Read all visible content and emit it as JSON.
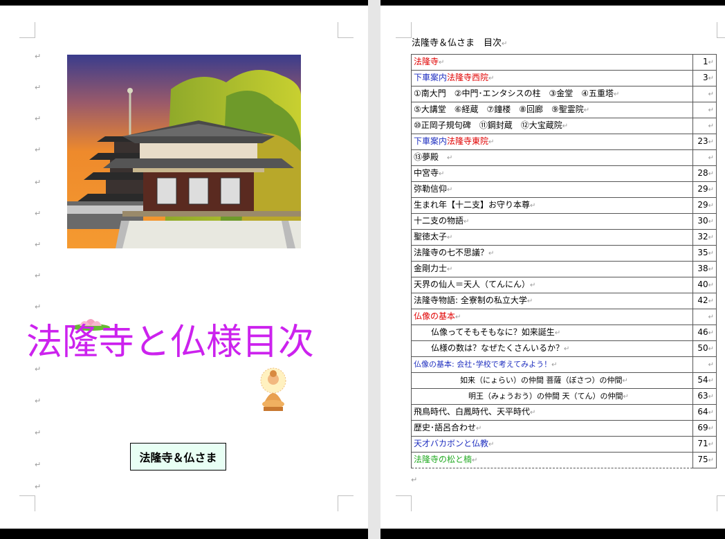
{
  "left_page": {
    "title": "法隆寺と仏様目次",
    "label": "法隆寺＆仏さま",
    "paragraph_mark": "↵"
  },
  "right_page": {
    "heading": "法隆寺＆仏さま　目次",
    "trailing_mark": "↵",
    "toc": [
      {
        "parts": [
          {
            "t": "法隆寺",
            "c": "red"
          }
        ],
        "page": "1"
      },
      {
        "parts": [
          {
            "t": "下車案内",
            "c": "blue"
          },
          {
            "t": "法隆寺西院",
            "c": "red"
          }
        ],
        "page": "3"
      },
      {
        "parts": [
          {
            "t": "①南大門　②中門･エンタシスの柱　③金堂　④五重塔",
            "c": "black"
          }
        ],
        "page": ""
      },
      {
        "parts": [
          {
            "t": "⑤大講堂　⑥経蔵　⑦鐘楼　⑧回廊　⑨聖霊院",
            "c": "black"
          }
        ],
        "page": ""
      },
      {
        "parts": [
          {
            "t": "⑩正岡子規句碑　⑪鋼封蔵　⑫大宝蔵院",
            "c": "black"
          }
        ],
        "page": ""
      },
      {
        "parts": [
          {
            "t": "下車案内",
            "c": "blue"
          },
          {
            "t": "法隆寺東院",
            "c": "red"
          }
        ],
        "page": "23"
      },
      {
        "parts": [
          {
            "t": "⑬夢殿　",
            "c": "black"
          }
        ],
        "page": ""
      },
      {
        "parts": [
          {
            "t": "中宮寺",
            "c": "black"
          }
        ],
        "page": "28"
      },
      {
        "parts": [
          {
            "t": "弥勒信仰",
            "c": "black"
          }
        ],
        "page": "29"
      },
      {
        "parts": [
          {
            "t": "生まれ年【十二支】お守り本尊",
            "c": "black"
          }
        ],
        "page": "29"
      },
      {
        "parts": [
          {
            "t": "十二支の物語",
            "c": "black"
          }
        ],
        "page": "30"
      },
      {
        "parts": [
          {
            "t": "聖徳太子",
            "c": "black"
          }
        ],
        "page": "32"
      },
      {
        "parts": [
          {
            "t": "法隆寺の七不思議？",
            "c": "black"
          }
        ],
        "page": "35"
      },
      {
        "parts": [
          {
            "t": "金剛力士",
            "c": "black"
          }
        ],
        "page": "38"
      },
      {
        "parts": [
          {
            "t": "天界の仙人＝天人（てんにん）",
            "c": "black"
          }
        ],
        "page": "40"
      },
      {
        "parts": [
          {
            "t": "法隆寺物語: 全寮制の私立大学",
            "c": "black"
          }
        ],
        "page": "42"
      },
      {
        "parts": [
          {
            "t": "仏像の基本",
            "c": "red"
          }
        ],
        "page": ""
      },
      {
        "parts": [
          {
            "t": "仏像ってそもそもなに？如来誕生",
            "c": "black"
          }
        ],
        "page": "46",
        "indent": 1
      },
      {
        "parts": [
          {
            "t": "仏様の数は？なぜたくさんいるか？",
            "c": "black"
          }
        ],
        "page": "50",
        "indent": 1
      },
      {
        "parts": [
          {
            "t": "仏像の基本: 会社･学校で考えてみよう！",
            "c": "blue"
          }
        ],
        "page": "",
        "small": true
      },
      {
        "parts": [
          {
            "t": "如来（にょらい）の仲間  菩薩（ぼさつ）の仲間",
            "c": "black"
          }
        ],
        "page": "54",
        "indent": 2,
        "small": true
      },
      {
        "parts": [
          {
            "t": "明王（みょうおう）の仲間  天（てん）の仲間",
            "c": "black"
          }
        ],
        "page": "63",
        "indent": 3,
        "small": true
      },
      {
        "parts": [
          {
            "t": "飛鳥時代、白鳳時代、天平時代",
            "c": "black"
          }
        ],
        "page": "64"
      },
      {
        "parts": [
          {
            "t": "歴史･語呂合わせ",
            "c": "black"
          }
        ],
        "page": "69"
      },
      {
        "parts": [
          {
            "t": "天才バカボンと仏教",
            "c": "blue"
          }
        ],
        "page": "71"
      },
      {
        "parts": [
          {
            "t": "法隆寺の松と楠",
            "c": "green"
          }
        ],
        "page": "75"
      }
    ]
  },
  "colors": {
    "title": "#cc22ee",
    "red": "#e00000",
    "blue": "#2030c0",
    "green": "#22aa22",
    "label_bg": "#e8fff4"
  },
  "icons": [
    "pagoda-illustration",
    "lotus-icon",
    "buddha-icon"
  ]
}
